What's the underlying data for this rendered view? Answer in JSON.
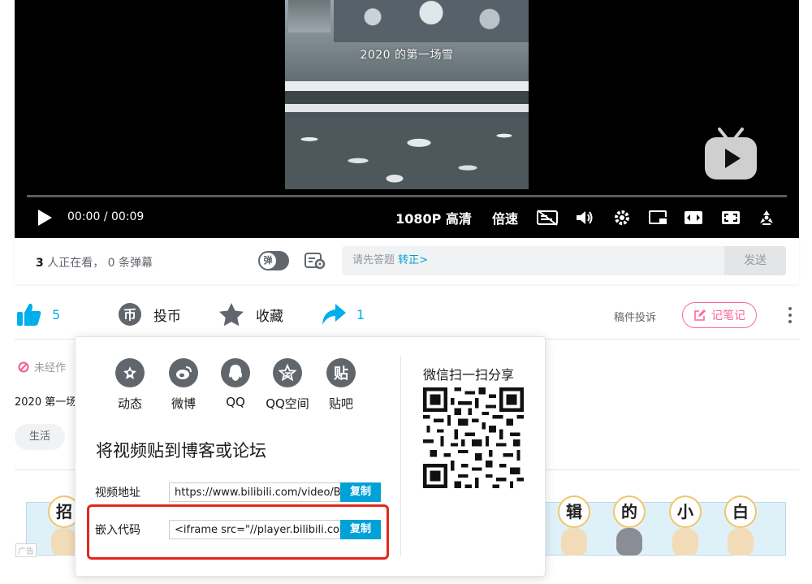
{
  "player": {
    "frame_caption": "2020 的第一场雪",
    "time_current": "00:00",
    "time_total": "00:09",
    "time_separator": "/",
    "quality": "1080P 高清",
    "speed": "倍速",
    "progress": 0.0
  },
  "danmaku_bar": {
    "watching_count": "3",
    "watching_text": "人正在看，",
    "danmaku_count": "0",
    "danmaku_text": "条弹幕",
    "toggle_label": "弹",
    "input_placeholder": "请先答题",
    "input_link": "转正>",
    "send_label": "发送"
  },
  "toolbar": {
    "like_count": "5",
    "coin_label": "投币",
    "collect_label": "收藏",
    "share_count": "1",
    "report_label": "稿件投诉",
    "note_label": "记笔记"
  },
  "content": {
    "meta_text": "未经作",
    "desc_text": "2020 第一场",
    "tag_label": "生活",
    "ad_label": "广告",
    "ad_chars": [
      "招",
      "辑",
      "的",
      "小",
      "白"
    ]
  },
  "share_popup": {
    "items": [
      {
        "label": "动态",
        "icon": "dynamic-icon"
      },
      {
        "label": "微博",
        "icon": "weibo-icon"
      },
      {
        "label": "QQ",
        "icon": "qq-icon"
      },
      {
        "label": "QQ空间",
        "icon": "qzone-icon"
      },
      {
        "label": "贴吧",
        "icon": "tieba-icon",
        "glyph": "贴"
      }
    ],
    "embed_title": "将视频贴到博客或论坛",
    "video_url_label": "视频地址",
    "video_url_value": "https://www.bilibili.com/video/BV",
    "embed_code_label": "嵌入代码",
    "embed_code_value": "<iframe src=\"//player.bilibili.com/player.html",
    "copy_label": "复制",
    "wechat_title": "微信扫一扫分享"
  },
  "colors": {
    "accent_blue": "#00a1d6",
    "like_blue": "#00aeec",
    "note_pink": "#ff6699",
    "highlight_red": "#e3261d"
  }
}
